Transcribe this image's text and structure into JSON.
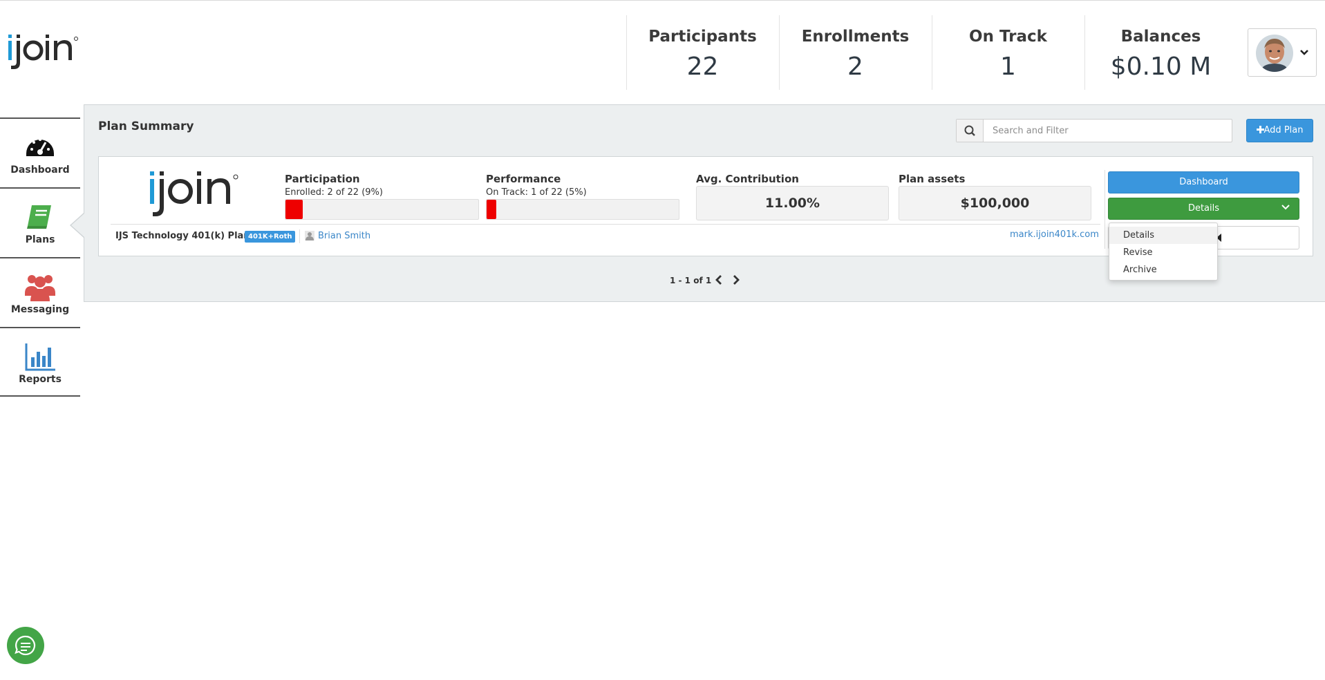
{
  "brand": {
    "logo_text": "ijoin",
    "color_blue": "#1f9ad6",
    "color_dark": "#2b2b2b"
  },
  "header": {
    "stats": [
      {
        "label": "Participants",
        "value": "22"
      },
      {
        "label": "Enrollments",
        "value": "2"
      },
      {
        "label": "On Track",
        "value": "1"
      },
      {
        "label": "Balances",
        "value": "$0.10 M"
      }
    ],
    "user_menu_icon": "chevron-down-icon"
  },
  "sidebar": {
    "items": [
      {
        "label": "Dashboard",
        "icon": "speedometer-icon",
        "color": "#111111"
      },
      {
        "label": "Plans",
        "icon": "book-icon",
        "color": "#4cae4c",
        "active": true
      },
      {
        "label": "Messaging",
        "icon": "users-icon",
        "color": "#d9534f"
      },
      {
        "label": "Reports",
        "icon": "bar-chart-icon",
        "color": "#3a86c8"
      }
    ]
  },
  "main": {
    "title": "Plan Summary",
    "search": {
      "placeholder": "Search and Filter",
      "value": "",
      "icon": "search-icon"
    },
    "add_button": {
      "label": "Add Plan",
      "icon": "plus-icon"
    },
    "plan": {
      "participation": {
        "title": "Participation",
        "subtitle": "Enrolled: 2 of 22 (9%)",
        "fill_percent": 9
      },
      "performance": {
        "title": "Performance",
        "subtitle": "On Track: 1 of 22 (5%)",
        "fill_percent": 5
      },
      "avg_contribution": {
        "title": "Avg. Contribution",
        "value": "11.00%"
      },
      "plan_assets": {
        "title": "Plan assets",
        "value": "$100,000"
      },
      "name": "IJS Technology 401(k) Plan",
      "badge": "401K+Roth",
      "contact": "Brian Smith",
      "url": "mark.ijoin401k.com",
      "actions": {
        "dashboard_label": "Dashboard",
        "details_label": "Details",
        "dropdown": [
          "Details",
          "Revise",
          "Archive"
        ]
      }
    },
    "pagination": {
      "text": "1 - 1 of 1"
    }
  },
  "chat": {
    "icon": "chat-icon",
    "color": "#43a547"
  }
}
